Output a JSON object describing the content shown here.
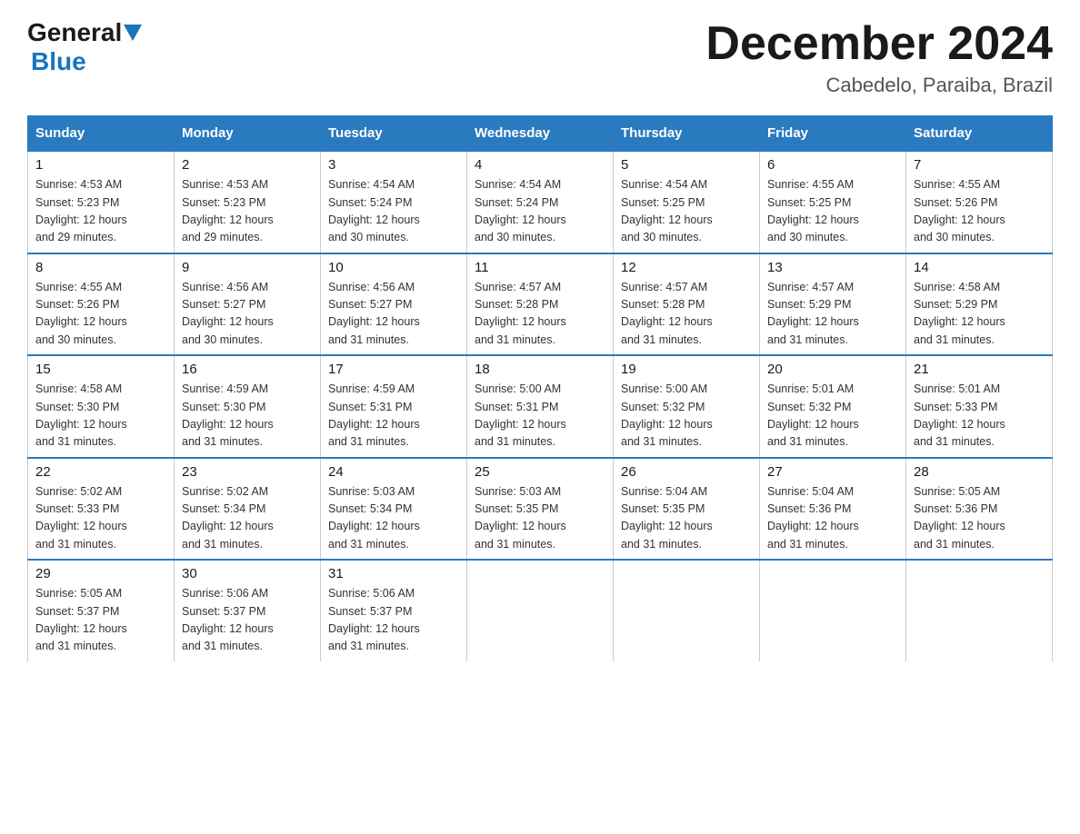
{
  "logo": {
    "general": "General",
    "blue": "Blue"
  },
  "title": "December 2024",
  "subtitle": "Cabedelo, Paraiba, Brazil",
  "days_of_week": [
    "Sunday",
    "Monday",
    "Tuesday",
    "Wednesday",
    "Thursday",
    "Friday",
    "Saturday"
  ],
  "weeks": [
    [
      {
        "day": "1",
        "sunrise": "4:53 AM",
        "sunset": "5:23 PM",
        "daylight": "12 hours and 29 minutes."
      },
      {
        "day": "2",
        "sunrise": "4:53 AM",
        "sunset": "5:23 PM",
        "daylight": "12 hours and 29 minutes."
      },
      {
        "day": "3",
        "sunrise": "4:54 AM",
        "sunset": "5:24 PM",
        "daylight": "12 hours and 30 minutes."
      },
      {
        "day": "4",
        "sunrise": "4:54 AM",
        "sunset": "5:24 PM",
        "daylight": "12 hours and 30 minutes."
      },
      {
        "day": "5",
        "sunrise": "4:54 AM",
        "sunset": "5:25 PM",
        "daylight": "12 hours and 30 minutes."
      },
      {
        "day": "6",
        "sunrise": "4:55 AM",
        "sunset": "5:25 PM",
        "daylight": "12 hours and 30 minutes."
      },
      {
        "day": "7",
        "sunrise": "4:55 AM",
        "sunset": "5:26 PM",
        "daylight": "12 hours and 30 minutes."
      }
    ],
    [
      {
        "day": "8",
        "sunrise": "4:55 AM",
        "sunset": "5:26 PM",
        "daylight": "12 hours and 30 minutes."
      },
      {
        "day": "9",
        "sunrise": "4:56 AM",
        "sunset": "5:27 PM",
        "daylight": "12 hours and 30 minutes."
      },
      {
        "day": "10",
        "sunrise": "4:56 AM",
        "sunset": "5:27 PM",
        "daylight": "12 hours and 31 minutes."
      },
      {
        "day": "11",
        "sunrise": "4:57 AM",
        "sunset": "5:28 PM",
        "daylight": "12 hours and 31 minutes."
      },
      {
        "day": "12",
        "sunrise": "4:57 AM",
        "sunset": "5:28 PM",
        "daylight": "12 hours and 31 minutes."
      },
      {
        "day": "13",
        "sunrise": "4:57 AM",
        "sunset": "5:29 PM",
        "daylight": "12 hours and 31 minutes."
      },
      {
        "day": "14",
        "sunrise": "4:58 AM",
        "sunset": "5:29 PM",
        "daylight": "12 hours and 31 minutes."
      }
    ],
    [
      {
        "day": "15",
        "sunrise": "4:58 AM",
        "sunset": "5:30 PM",
        "daylight": "12 hours and 31 minutes."
      },
      {
        "day": "16",
        "sunrise": "4:59 AM",
        "sunset": "5:30 PM",
        "daylight": "12 hours and 31 minutes."
      },
      {
        "day": "17",
        "sunrise": "4:59 AM",
        "sunset": "5:31 PM",
        "daylight": "12 hours and 31 minutes."
      },
      {
        "day": "18",
        "sunrise": "5:00 AM",
        "sunset": "5:31 PM",
        "daylight": "12 hours and 31 minutes."
      },
      {
        "day": "19",
        "sunrise": "5:00 AM",
        "sunset": "5:32 PM",
        "daylight": "12 hours and 31 minutes."
      },
      {
        "day": "20",
        "sunrise": "5:01 AM",
        "sunset": "5:32 PM",
        "daylight": "12 hours and 31 minutes."
      },
      {
        "day": "21",
        "sunrise": "5:01 AM",
        "sunset": "5:33 PM",
        "daylight": "12 hours and 31 minutes."
      }
    ],
    [
      {
        "day": "22",
        "sunrise": "5:02 AM",
        "sunset": "5:33 PM",
        "daylight": "12 hours and 31 minutes."
      },
      {
        "day": "23",
        "sunrise": "5:02 AM",
        "sunset": "5:34 PM",
        "daylight": "12 hours and 31 minutes."
      },
      {
        "day": "24",
        "sunrise": "5:03 AM",
        "sunset": "5:34 PM",
        "daylight": "12 hours and 31 minutes."
      },
      {
        "day": "25",
        "sunrise": "5:03 AM",
        "sunset": "5:35 PM",
        "daylight": "12 hours and 31 minutes."
      },
      {
        "day": "26",
        "sunrise": "5:04 AM",
        "sunset": "5:35 PM",
        "daylight": "12 hours and 31 minutes."
      },
      {
        "day": "27",
        "sunrise": "5:04 AM",
        "sunset": "5:36 PM",
        "daylight": "12 hours and 31 minutes."
      },
      {
        "day": "28",
        "sunrise": "5:05 AM",
        "sunset": "5:36 PM",
        "daylight": "12 hours and 31 minutes."
      }
    ],
    [
      {
        "day": "29",
        "sunrise": "5:05 AM",
        "sunset": "5:37 PM",
        "daylight": "12 hours and 31 minutes."
      },
      {
        "day": "30",
        "sunrise": "5:06 AM",
        "sunset": "5:37 PM",
        "daylight": "12 hours and 31 minutes."
      },
      {
        "day": "31",
        "sunrise": "5:06 AM",
        "sunset": "5:37 PM",
        "daylight": "12 hours and 31 minutes."
      },
      null,
      null,
      null,
      null
    ]
  ],
  "labels": {
    "sunrise": "Sunrise:",
    "sunset": "Sunset:",
    "daylight": "Daylight:"
  }
}
